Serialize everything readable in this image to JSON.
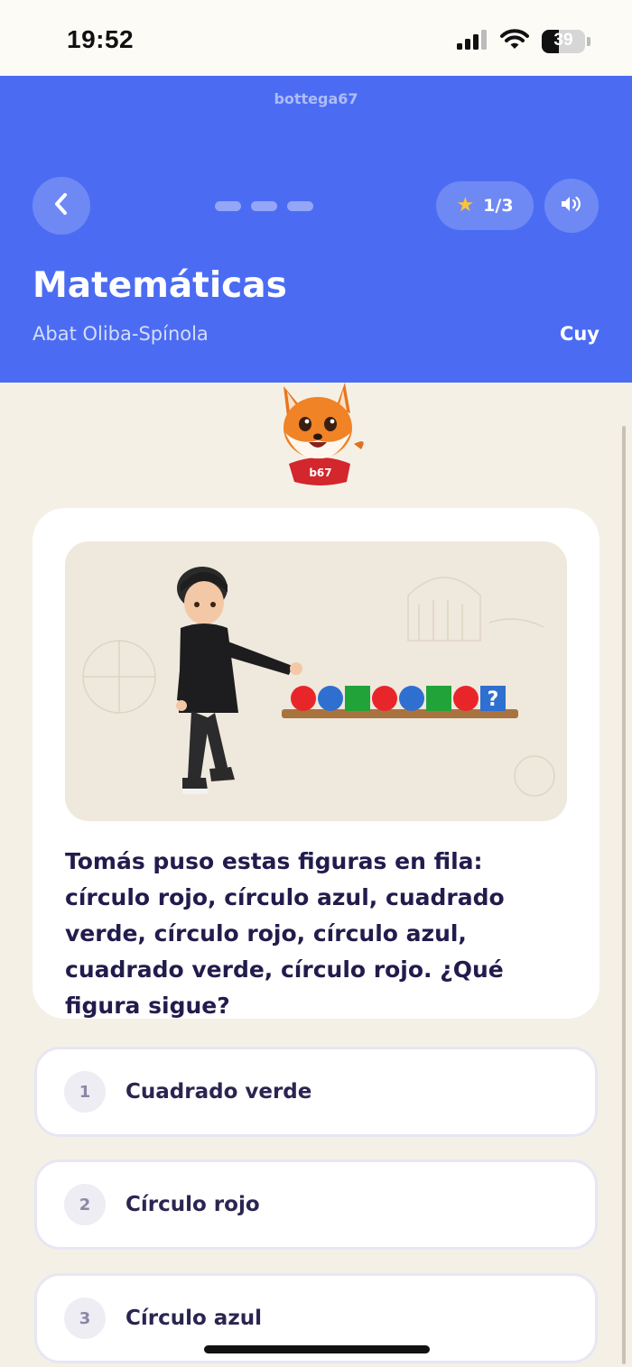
{
  "status_bar": {
    "time": "19:52",
    "battery_percent": "39",
    "battery_level": 0.39
  },
  "header": {
    "brand": "bottega67",
    "subject": "Matemáticas",
    "school": "Abat Oliba-Spínola",
    "class_name": "Cuy",
    "score": "1/3",
    "progress_steps": 3
  },
  "mascot": {
    "badge": "b67"
  },
  "question": {
    "text": "Tomás puso estas figuras en fila: círculo rojo, círculo azul, cuadrado verde, círculo rojo, círculo azul, cuadrado verde, círculo rojo. ¿Qué figura sigue?",
    "image_question_mark": "?"
  },
  "options": [
    {
      "number": "1",
      "label": "Cuadrado verde"
    },
    {
      "number": "2",
      "label": "Círculo rojo"
    },
    {
      "number": "3",
      "label": "Círculo azul"
    }
  ],
  "colors": {
    "header_blue": "#4b6cf2",
    "background": "#f5f0e6",
    "star": "#f8c43a",
    "question_text": "#221c4d",
    "shape_red": "#e8262a",
    "shape_blue": "#2f6fd0",
    "shape_green": "#22a33a"
  }
}
